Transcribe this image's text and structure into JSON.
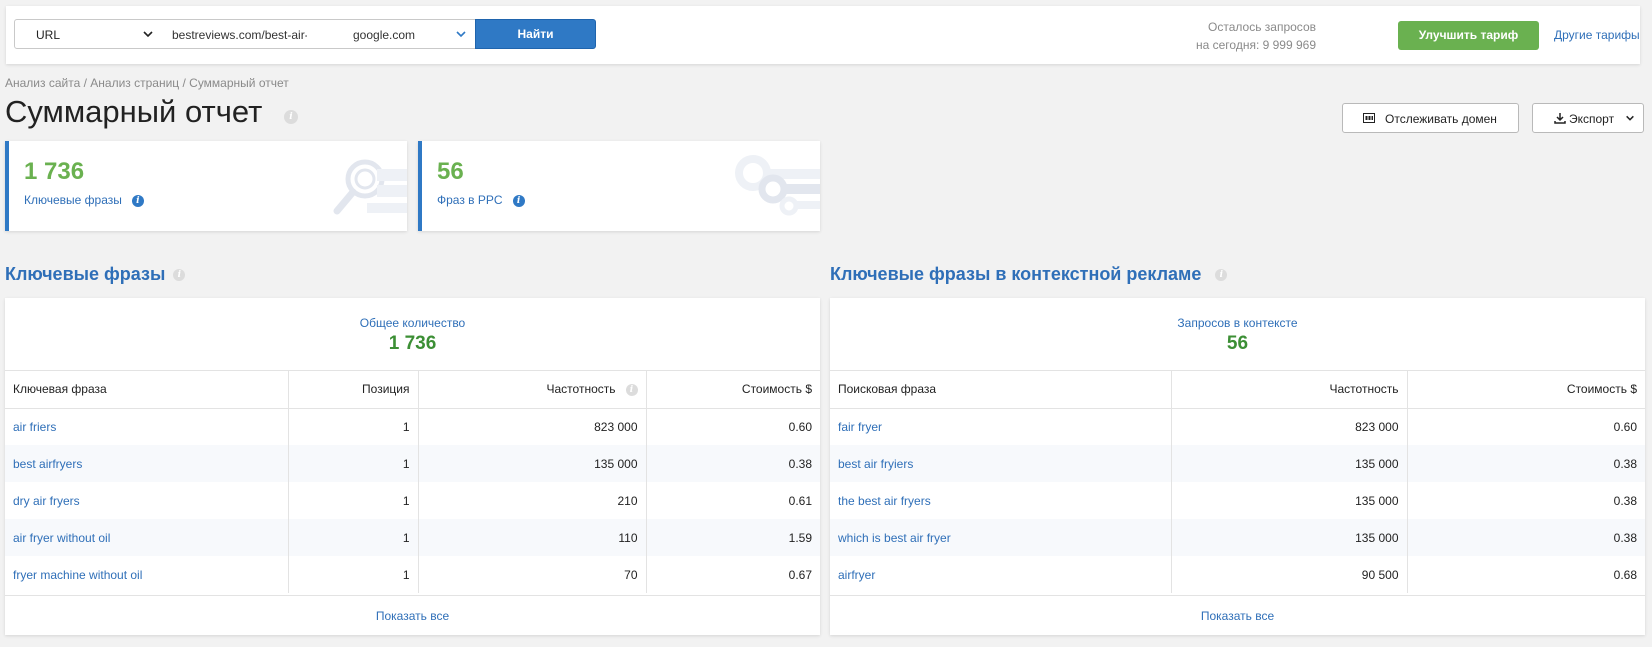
{
  "topbar": {
    "type_select": "URL",
    "url_value": "bestreviews.com/best-air-",
    "engine_select": "google.com",
    "find_button": "Найти",
    "quota_line1": "Осталось запросов",
    "quota_line2": "на сегодня: 9 999 969",
    "upgrade_button": "Улучшить тариф",
    "other_plans_link": "Другие тарифы"
  },
  "breadcrumb": "Анализ сайта / Анализ страниц / Суммарный отчет",
  "page_title": "Суммарный отчет",
  "actions": {
    "track_domain": "Отслеживать домен",
    "export": "Экспорт"
  },
  "cards": [
    {
      "value": "1 736",
      "label": "Ключевые фразы",
      "icon": "magnifier-icon"
    },
    {
      "value": "56",
      "label": "Фраз в PPC",
      "icon": "keys-icon"
    }
  ],
  "keywords": {
    "title": "Ключевые фразы",
    "summary_caption": "Общее количество",
    "summary_value": "1 736",
    "columns": [
      "Ключевая фраза",
      "Позиция",
      "Частотность",
      "Стоимость $"
    ],
    "rows": [
      [
        "air friers",
        "1",
        "823 000",
        "0.60"
      ],
      [
        "best airfryers",
        "1",
        "135 000",
        "0.38"
      ],
      [
        "dry air fryers",
        "1",
        "210",
        "0.61"
      ],
      [
        "air fryer without oil",
        "1",
        "110",
        "1.59"
      ],
      [
        "fryer machine without oil",
        "1",
        "70",
        "0.67"
      ]
    ],
    "show_all": "Показать все"
  },
  "ppc": {
    "title": "Ключевые фразы в контекстной рекламе",
    "summary_caption": "Запросов в контексте",
    "summary_value": "56",
    "columns": [
      "Поисковая фраза",
      "Частотность",
      "Стоимость $"
    ],
    "rows": [
      [
        "fair fryer",
        "823 000",
        "0.60"
      ],
      [
        "best air fryiers",
        "135 000",
        "0.38"
      ],
      [
        "the best air fryers",
        "135 000",
        "0.38"
      ],
      [
        "which is best air fryer",
        "135 000",
        "0.38"
      ],
      [
        "airfryer",
        "90 500",
        "0.68"
      ]
    ],
    "show_all": "Показать все"
  },
  "colors": {
    "accent_blue": "#2f79c5",
    "link_blue": "#2f6fb8",
    "green": "#6ab150",
    "value_green": "#3c8f35"
  }
}
